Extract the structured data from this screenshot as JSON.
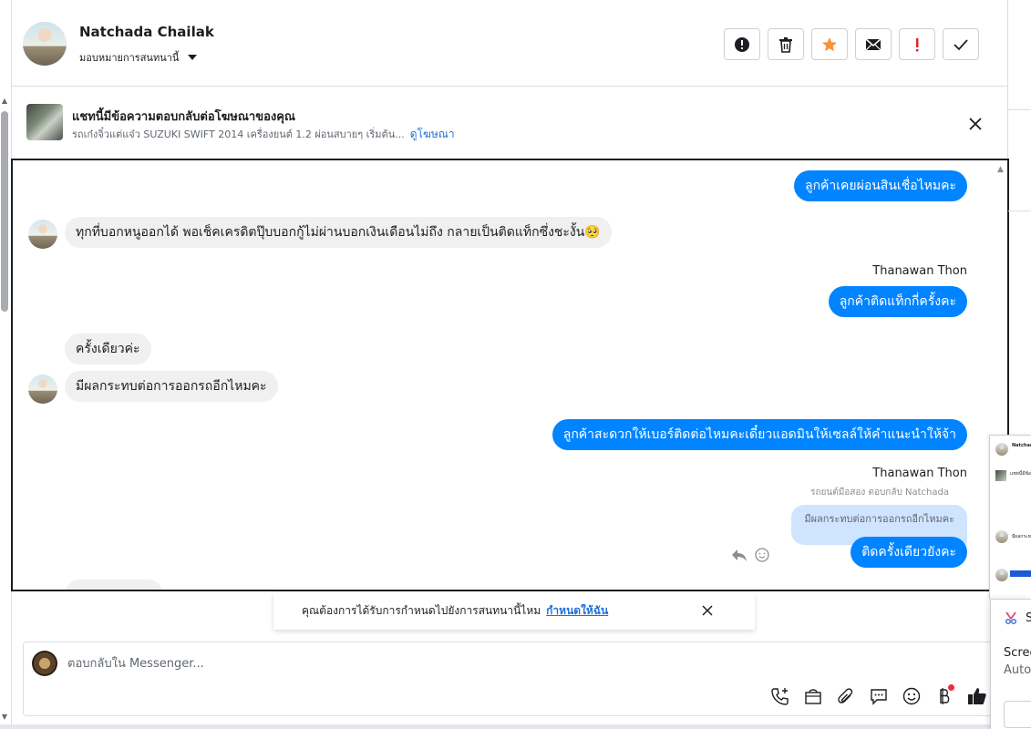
{
  "header": {
    "contact_name": "Natchada Chailak",
    "assign_label": "มอบหมายการสนทนานี้",
    "action_icons": [
      "alert-icon",
      "trash-icon",
      "star-icon",
      "envelope-icon",
      "exclamation-icon",
      "check-icon"
    ],
    "accent_color": "#f7923a"
  },
  "ad_banner": {
    "title": "แชทนี้มีข้อความตอบกลับต่อโฆษณาของคุณ",
    "subtitle": "รถเก๋งจิ๋วแต่แจ๋ว SUZUKI SWIFT 2014 เครื่องยนต์ 1.2 ผ่อนสบายๆ เริ่มต้น...",
    "link": "ดูโฆษณา"
  },
  "messages": {
    "m1_out": "ลูกค้าเคยผ่อนสินเชื่อไหมคะ",
    "m2_in": "ทุกที่บอกหนูออกได้ พอเช็คเครดิตปุ๊บบอกกู้ไม่ผ่านบอกเงินเดือนไม่ถึง กลายเป็นติดแท็กซึ่งชะงั้น🥺",
    "m3_sender": "Thanawan Thon",
    "m3_out": "ลูกค้าติดแท็กกี่ครั้งคะ",
    "m4_in": "ครั้งเดียวค่ะ",
    "m5_in": "มีผลกระทบต่อการออกรถอีกไหมคะ",
    "m6_out": "ลูกค้าสะดวกให้เบอร์ติดต่อไหมคะเดี๋ยวแอดมินให้เซลล์ให้คำแนะนำให้จ้า",
    "m7_sender": "Thanawan Thon",
    "m7_reply_note": "รถยนต์มือสอง ตอบกลับ Natchada",
    "m7_quoted": "มีผลกระทบต่อการออกรถอีกไหมคะ",
    "m7_out": "ติดครั้งเดียวยังคะ",
    "bubble_out_color": "#0084ff",
    "bubble_in_color": "#f0f0f0"
  },
  "prompt": {
    "text": "คุณต้องการได้รับการกำหนดไปยังการสนทนานี้ไหม",
    "link": "กำหนดให้ฉัน"
  },
  "composer": {
    "placeholder": "ตอบกลับใน Messenger...",
    "tools": [
      "phone-plus-icon",
      "shopping-bag-icon",
      "paperclip-icon",
      "chat-bubble-icon",
      "emoji-icon",
      "baht-icon",
      "thumbs-up-icon"
    ]
  },
  "side_toast": {
    "letter": "S",
    "title": "Scree",
    "sub": "Auto"
  }
}
